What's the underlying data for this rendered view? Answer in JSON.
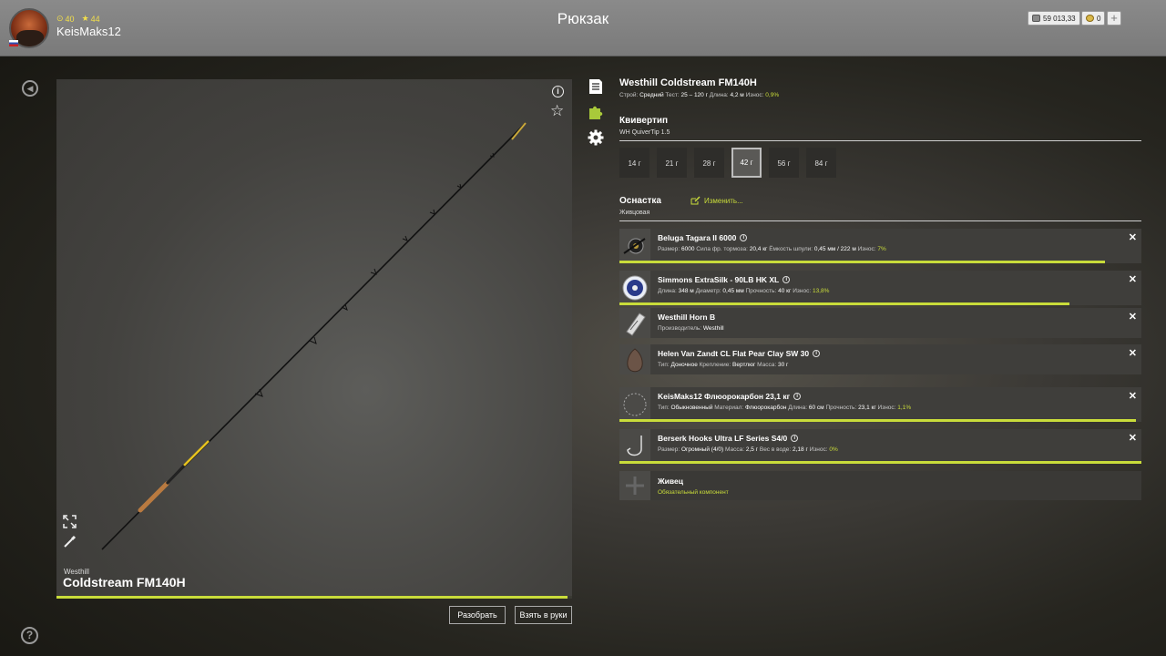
{
  "header": {
    "title": "Рюкзак",
    "username": "KeisMaks12",
    "stat_a": "40",
    "stat_b": "44",
    "currency_silver": "59 013,33",
    "currency_gold": "0",
    "plus": "+"
  },
  "rod": {
    "brand": "Westhill",
    "model": "Coldstream FM140H",
    "title": "Westhill Coldstream FM140H",
    "props": {
      "action_label": "Строй:",
      "action": "Средний",
      "test_label": "Тест:",
      "test": "25 – 120 г",
      "length_label": "Длина:",
      "length": "4,2 м",
      "wear_label": "Износ:",
      "wear": "0,9%"
    },
    "wear_fraction": 0.991
  },
  "quivertip": {
    "title": "Квивертип",
    "name": "WH QuiverTip 1.5",
    "options": [
      "14 г",
      "21 г",
      "28 г",
      "42 г",
      "56 г",
      "84 г"
    ],
    "selected": "42 г"
  },
  "rig": {
    "title": "Оснастка",
    "type": "Живцовая",
    "edit_label": "Изменить...",
    "items": [
      {
        "title": "Beluga Tagara II 6000",
        "thumb": "reel-icon",
        "props": [
          [
            "Размер:",
            "6000"
          ],
          [
            "Сила фр. тормоза:",
            "20,4 кг"
          ],
          [
            "Ёмкость шпули:",
            "0,45 мм / 222 м"
          ],
          [
            "Износ:",
            "7%"
          ]
        ],
        "condition": 0.93
      },
      {
        "title": "Simmons ExtraSilk - 90LB HK XL",
        "thumb": "line-spool-icon",
        "props": [
          [
            "Длина:",
            "348 м"
          ],
          [
            "Диаметр:",
            "0,45 мм"
          ],
          [
            "Прочность:",
            "40 кг"
          ],
          [
            "Износ:",
            "13,8%"
          ]
        ],
        "condition": 0.862
      },
      {
        "title": "Westhill Horn B",
        "thumb": "feeder-bell-icon",
        "props": [
          [
            "Производитель:",
            "Westhill"
          ]
        ]
      },
      {
        "title": "Helen Van Zandt CL Flat Pear Clay SW 30",
        "thumb": "sinker-icon",
        "props": [
          [
            "Тип:",
            "Доночное"
          ],
          [
            "Крепление:",
            "Вертлюг"
          ],
          [
            "Масса:",
            "30 г"
          ]
        ]
      },
      {
        "title": "KeisMaks12 Флюорокарбон 23,1 кг",
        "thumb": "leader-icon",
        "props": [
          [
            "Тип:",
            "Обыкновенный"
          ],
          [
            "Материал:",
            "Флюорокарбон"
          ],
          [
            "Длина:",
            "60 см"
          ],
          [
            "Прочность:",
            "23,1 кг"
          ],
          [
            "Износ:",
            "1,1%"
          ]
        ],
        "condition": 0.989
      },
      {
        "title": "Berserk Hooks Ultra LF Series S4/0",
        "thumb": "hook-icon",
        "props": [
          [
            "Размер:",
            "Огромный (4/0)"
          ],
          [
            "Масса:",
            "2,5 г"
          ],
          [
            "Вес в воде:",
            "2,18 г"
          ],
          [
            "Износ:",
            "0%"
          ]
        ],
        "condition": 1.0
      },
      {
        "title": "Живец",
        "thumb": "add-icon",
        "subtitle": "Обязательный компонент"
      }
    ]
  },
  "buttons": {
    "disassemble": "Разобрать",
    "take": "Взять в руки"
  },
  "colors": {
    "accent": "#c9dc3a",
    "row_bg": "#3f3e3b",
    "topbar": "#7f7f7f"
  }
}
